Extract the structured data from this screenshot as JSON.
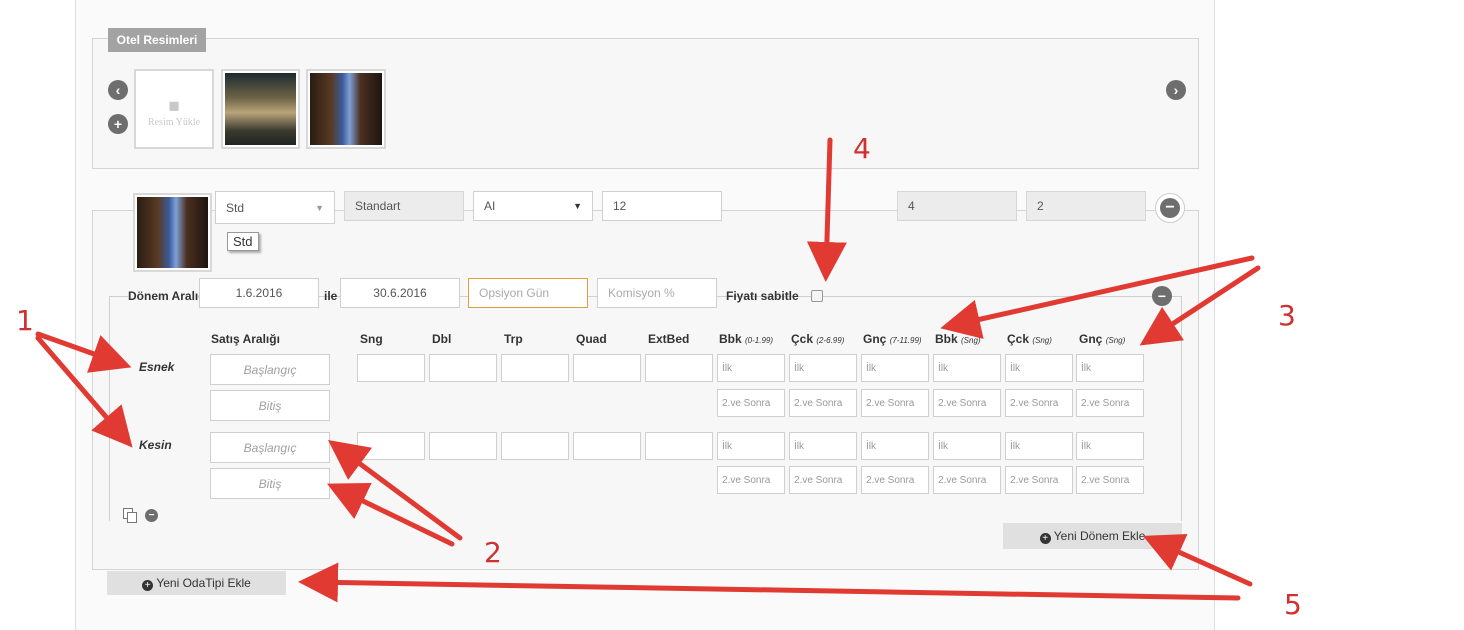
{
  "gallery": {
    "title": "Otel Resimleri",
    "upload_label": "Resim Yükle",
    "upload_icon": "camera-icon",
    "prev_icon": "arrow-left-circle-icon",
    "add_icon": "plus-circle-icon",
    "next_icon": "arrow-right-circle-icon"
  },
  "room": {
    "code_value": "Std",
    "code_tooltip": "Std",
    "name_value": "Standart",
    "board_value": "AI",
    "qty_value": "12",
    "field_a": "4",
    "field_b": "2"
  },
  "period": {
    "label": "Dönem Aralığı",
    "start": "1.6.2016",
    "between": "ile",
    "end": "30.6.2016",
    "option_placeholder": "Opsiyon Gün",
    "commission_placeholder": "Komisyon %",
    "fixed_label": "Fiyatı sabitle",
    "fixed_checked": false
  },
  "price_table": {
    "headers": {
      "sale_range": "Satış Aralığı",
      "sng": "Sng",
      "dbl": "Dbl",
      "trp": "Trp",
      "quad": "Quad",
      "extbed": "ExtBed",
      "bbk1": "Bbk",
      "bbk1_sub": "(0-1.99)",
      "cck1": "Çck",
      "cck1_sub": "(2-6.99)",
      "gnc1": "Gnç",
      "gnc1_sub": "(7-11.99)",
      "bbk2": "Bbk",
      "bbk2_sub": "(Sng)",
      "cck2": "Çck",
      "cck2_sub": "(Sng)",
      "gnc2": "Gnç",
      "gnc2_sub": "(Sng)"
    },
    "rows": [
      {
        "label": "Esnek",
        "start_placeholder": "Başlangıç",
        "end_placeholder": "Bitiş"
      },
      {
        "label": "Kesin",
        "start_placeholder": "Başlangıç",
        "end_placeholder": "Bitiş"
      }
    ],
    "first_placeholder": "İlk",
    "after_placeholder": "2.ve Sonra"
  },
  "buttons": {
    "new_period": "Yeni Dönem Ekle",
    "new_room_type": "Yeni OdaTipi Ekle"
  },
  "annotations": {
    "n1": "1",
    "n2": "2",
    "n3": "3",
    "n4": "4",
    "n5": "5",
    "color": "#e03a32"
  }
}
